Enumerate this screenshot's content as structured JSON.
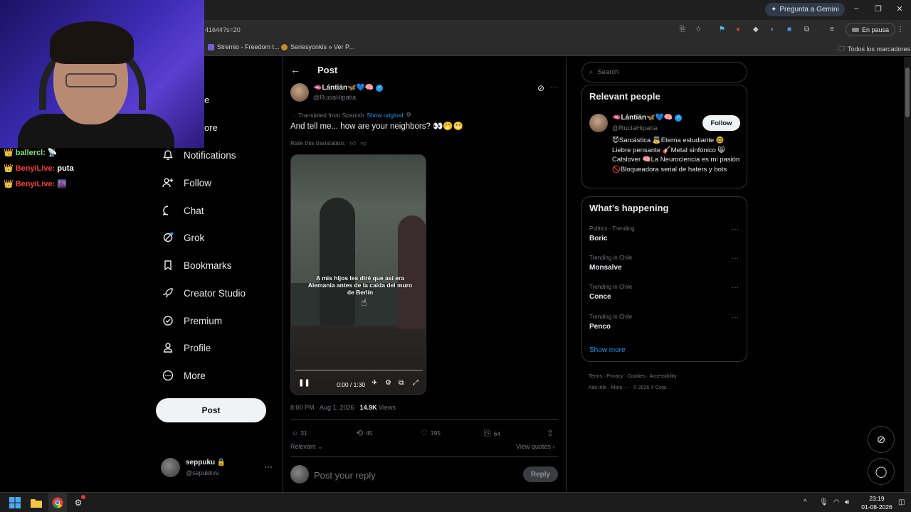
{
  "browser": {
    "gemini_button": "Pregunta a Gemini",
    "address": "41644?s=20",
    "extension_pill": "En pausa",
    "bookmarks": [
      "Stremio - Freedom t...",
      "Seriesyonkis » Ver P..."
    ],
    "all_bookmarks": "Todos los marcadores"
  },
  "chat": [
    {
      "crown": "👑",
      "user": "ballercl:",
      "message": "📡"
    },
    {
      "crown": "👑",
      "user": "BenyiLive:",
      "message": "puta"
    },
    {
      "crown": "👑",
      "user": "BenyiLive:",
      "message": "🌆"
    }
  ],
  "nav": {
    "partial_1": "e",
    "partial_2": "ore",
    "items": [
      {
        "label": "Notifications",
        "icon": "bell-icon"
      },
      {
        "label": "Follow",
        "icon": "add-person-icon"
      },
      {
        "label": "Chat",
        "icon": "chat-bubble-icon"
      },
      {
        "label": "Grok",
        "icon": "grok-icon"
      },
      {
        "label": "Bookmarks",
        "icon": "bookmark-icon"
      },
      {
        "label": "Creator Studio",
        "icon": "rocket-icon"
      },
      {
        "label": "Premium",
        "icon": "check-circle-icon"
      },
      {
        "label": "Profile",
        "icon": "person-icon"
      },
      {
        "label": "More",
        "icon": "more-circle-icon"
      }
    ],
    "post_button": "Post"
  },
  "account": {
    "name": "seppuku 🔒",
    "handle": "@sepukkvv"
  },
  "post": {
    "header_title": "Post",
    "author_name": "🫦Lántiän🦋💙🧠",
    "author_handle": "@RuciaHipatia",
    "translated_label": "Translated from Spanish",
    "show_original": "Show original",
    "text": "And tell me... how are your neighbors? 👀🤭😬",
    "rate_label": "Rate this translation:",
    "video_caption": "A mis hijos les diré que así era Alemania antes de la caída del muro de Berlín",
    "video_time": "0:00 / 1:30",
    "timestamp": "8:00 PM · Aug 1, 2026 · ",
    "views_count": "14.9K",
    "views_label": " Views",
    "replies": "31",
    "reposts": "45",
    "likes": "195",
    "bookmarks": "64",
    "relevant": "Relevant",
    "view_quotes": "View quotes",
    "reply_placeholder": "Post your reply",
    "reply_button": "Reply"
  },
  "sidebar": {
    "search_placeholder": "Search",
    "relevant_title": "Relevant people",
    "person_name": "🫦Lántiän🦋💙🧠",
    "person_handle": "@RuciaHipatia",
    "follow_button": "Follow",
    "person_bio": "😈Sarcástica 👼Eterna estudiante 🤓 Liebre pensante 🎸Metal sinfónico 😸 Catslover 🧠La Neurociencia es mi pasión 🚫Bloqueadora serial de haters y bots",
    "happening_title": "What’s happening",
    "trends": [
      {
        "meta": "Politics · Trending",
        "name": "Boric"
      },
      {
        "meta": "Trending in Chile",
        "name": "Monsalve"
      },
      {
        "meta": "Trending in Chile",
        "name": "Conce"
      },
      {
        "meta": "Trending in Chile",
        "name": "Penco"
      }
    ],
    "show_more": "Show more",
    "footer_line_1": "Terms · Privacy · Cookies · Accessibility ·",
    "footer_line_2": "Ads info · More ··· · © 2026 X Corp."
  },
  "taskbar": {
    "time": "23:19",
    "date": "01-08-2026"
  },
  "colors": {
    "accent": "#1d9bf0",
    "background": "#000000",
    "muted": "#71767b"
  }
}
